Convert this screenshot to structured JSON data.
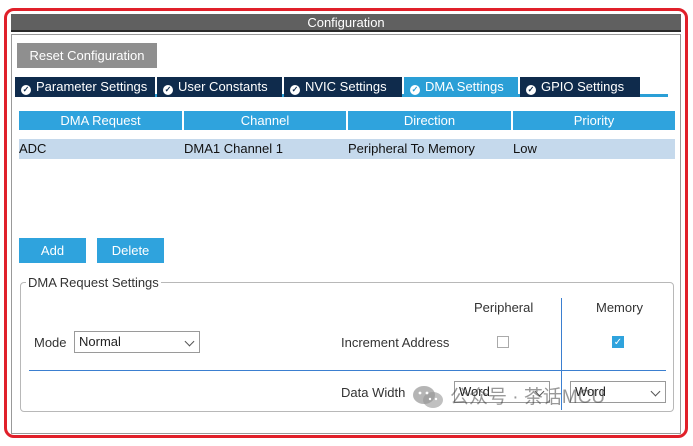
{
  "window": {
    "title": "Configuration"
  },
  "toolbar": {
    "reset_label": "Reset Configuration"
  },
  "tabs": [
    {
      "label": "Parameter Settings",
      "active": false,
      "icon": "check-circle-icon"
    },
    {
      "label": "User Constants",
      "active": false,
      "icon": "check-circle-icon"
    },
    {
      "label": "NVIC Settings",
      "active": false,
      "icon": "check-circle-icon"
    },
    {
      "label": "DMA Settings",
      "active": true,
      "icon": "check-circle-icon"
    },
    {
      "label": "GPIO Settings",
      "active": false,
      "icon": "check-circle-icon"
    }
  ],
  "table": {
    "headers": [
      "DMA Request",
      "Channel",
      "Direction",
      "Priority"
    ],
    "rows": [
      [
        "ADC",
        "DMA1 Channel 1",
        "Peripheral To Memory",
        "Low"
      ]
    ]
  },
  "actions": {
    "add_label": "Add",
    "delete_label": "Delete"
  },
  "settings": {
    "group_title": "DMA Request Settings",
    "mode_label": "Mode",
    "mode_value": "Normal",
    "peripheral_header": "Peripheral",
    "memory_header": "Memory",
    "increment_label": "Increment Address",
    "increment_peripheral": false,
    "increment_memory": true,
    "data_width_label": "Data Width",
    "data_width_peripheral": "Word",
    "data_width_memory": "Word"
  },
  "watermark": {
    "text": "公众号 · 茶话MCU"
  },
  "colors": {
    "accent": "#2fa3dd",
    "tab_dark": "#0f2b4c",
    "highlight_frame": "#e0202a",
    "row_selected": "#c5d9ec"
  }
}
